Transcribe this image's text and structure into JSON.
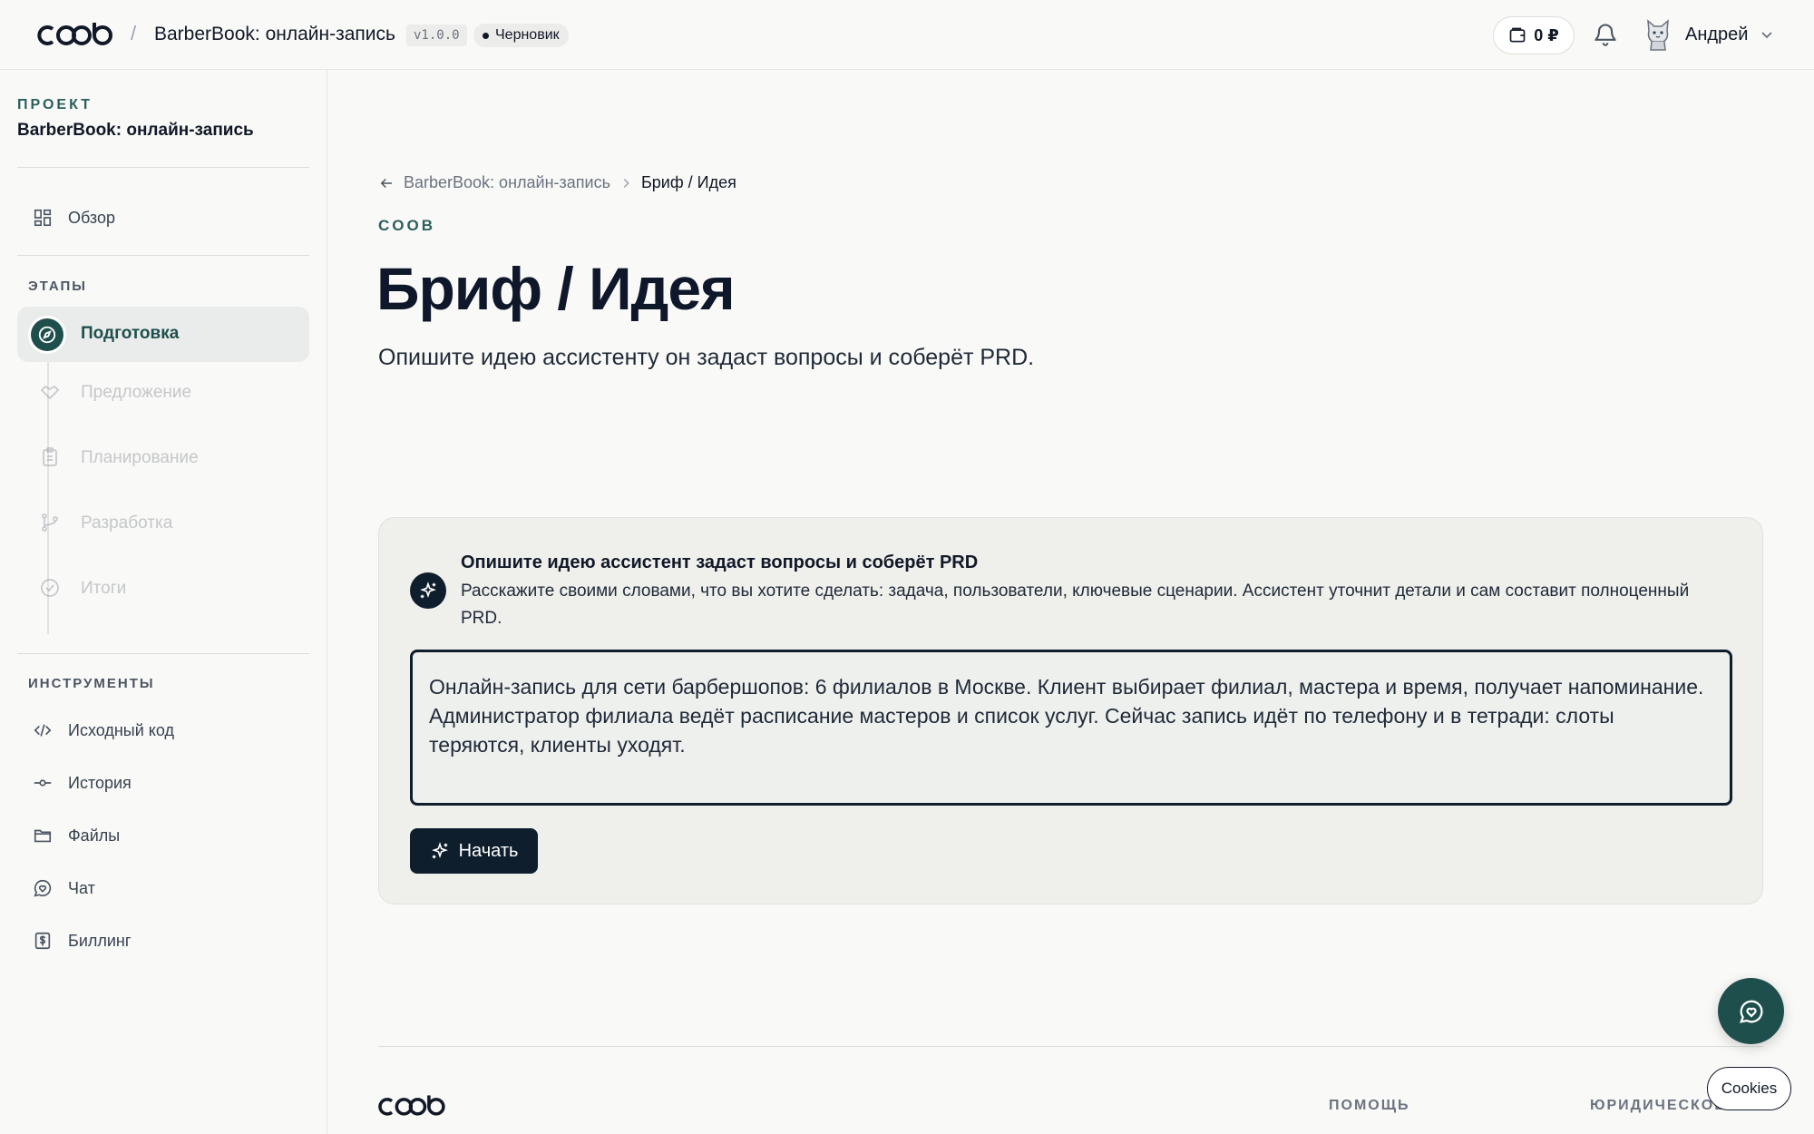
{
  "header": {
    "project_title": "BarberBook: онлайн-запись",
    "separator": "/",
    "version": "v1.0.0",
    "status": "Черновик",
    "balance": "0 ₽",
    "user_name": "Андрей"
  },
  "sidebar": {
    "project_label": "ПРОЕКТ",
    "project_name": "BarberBook: онлайн-запись",
    "overview": "Обзор",
    "stages_label": "ЭТАПЫ",
    "stages": [
      {
        "label": "Подготовка",
        "icon": "compass-icon",
        "active": true
      },
      {
        "label": "Предложение",
        "icon": "handshake-icon",
        "active": false
      },
      {
        "label": "Планирование",
        "icon": "clipboard-icon",
        "active": false
      },
      {
        "label": "Разработка",
        "icon": "git-branch-icon",
        "active": false
      },
      {
        "label": "Итоги",
        "icon": "check-circle-icon",
        "active": false
      }
    ],
    "tools_label": "ИНСТРУМЕНТЫ",
    "tools": [
      {
        "label": "Исходный код",
        "icon": "code-icon"
      },
      {
        "label": "История",
        "icon": "commit-icon"
      },
      {
        "label": "Файлы",
        "icon": "folder-icon"
      },
      {
        "label": "Чат",
        "icon": "chat-icon"
      },
      {
        "label": "Биллинг",
        "icon": "dollar-icon"
      }
    ]
  },
  "main": {
    "breadcrumb_parent": "BarberBook: онлайн-запись",
    "breadcrumb_current": "Бриф / Идея",
    "eyebrow": "COOB",
    "title": "Бриф / Идея",
    "subtitle": "Опишите идею ассистенту он задаст вопросы и соберёт PRD.",
    "card": {
      "title": "Опишите идею ассистент задаст вопросы и соберёт PRD",
      "description": "Расскажите своими словами, что вы хотите сделать: задача, пользователи, ключевые сценарии. Ассистент уточнит детали и сам составит полноценный PRD.",
      "idea_text": "Онлайн-запись для сети барбершопов: 6 филиалов в Москве. Клиент выбирает филиал, мастера и время, получает напоминание. Администратор филиала ведёт расписание мастеров и список услуг. Сейчас запись идёт по телефону и в тетради: слоты теряются, клиенты уходят.",
      "start_button": "Начать"
    }
  },
  "footer": {
    "help": "ПОМОЩЬ",
    "legal": "ЮРИДИЧЕСКОЕ"
  },
  "cookies_button": "Cookies",
  "colors": {
    "accent": "#1f4f4d",
    "dark": "#0f1e2d",
    "background": "#f9f9f7"
  }
}
